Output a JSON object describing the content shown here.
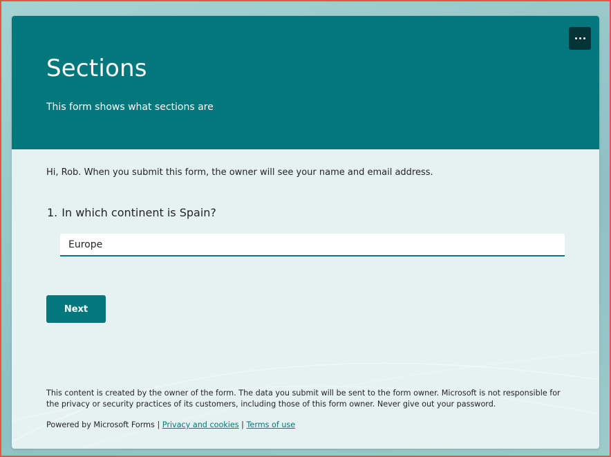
{
  "form": {
    "title": "Sections",
    "subtitle": "This form shows what sections are",
    "notice": "Hi, Rob. When you submit this form, the owner will see your name and email address."
  },
  "question": {
    "number": "1.",
    "text": "In which continent is Spain?",
    "answer_value": "Europe"
  },
  "buttons": {
    "next_label": "Next",
    "more_icon": "ellipsis-icon"
  },
  "disclaimer": "This content is created by the owner of the form. The data you submit will be sent to the form owner. Microsoft is not responsible for the privacy or security practices of its customers, including those of this form owner. Never give out your password.",
  "footer": {
    "powered_by": "Powered by Microsoft Forms",
    "separator": "|",
    "privacy_link": "Privacy and cookies",
    "terms_link": "Terms of use"
  },
  "colors": {
    "accent": "#03787c",
    "header_bg": "#03787c",
    "more_button_bg": "#053436",
    "card_bg": "#e6f1f1",
    "frame_border": "#e8524a"
  }
}
